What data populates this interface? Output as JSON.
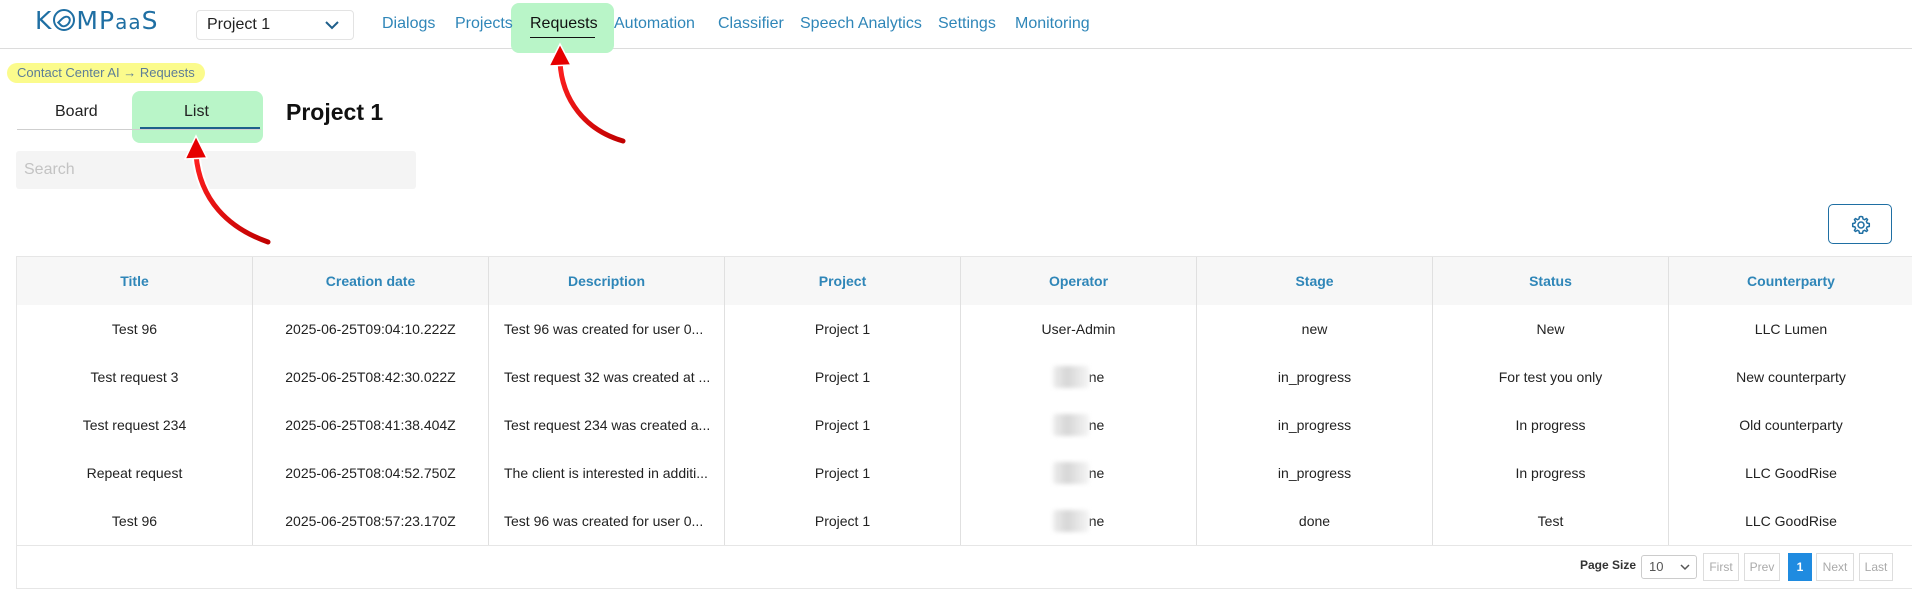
{
  "app": {
    "logo_left": "K",
    "logo_mid": "MP",
    "logo_aa": "aa",
    "logo_right": "S",
    "project_select": "Project 1"
  },
  "nav": {
    "items": [
      "Dialogs",
      "Projects",
      "Requests",
      "Automation",
      "Classifier",
      "Speech Analytics",
      "Settings",
      "Monitoring"
    ],
    "active": "Requests"
  },
  "breadcrumb": "Contact Center AI → Requests",
  "tabs": [
    "Board",
    "List"
  ],
  "active_tab": "List",
  "page_title": "Project 1",
  "search": {
    "placeholder": "Search",
    "value": ""
  },
  "table": {
    "columns": [
      "Title",
      "Creation date",
      "Description",
      "Project",
      "Operator",
      "Stage",
      "Status",
      "Counterparty"
    ],
    "rows": [
      [
        "Test 96",
        "2025-06-25T09:04:10.222Z",
        "Test 96 was created for user 0...",
        "Project 1",
        "User-Admin",
        "new",
        "New",
        "LLC Lumen"
      ],
      [
        "Test request 3",
        "2025-06-25T08:42:30.022Z",
        "Test request 32 was created at ...",
        "Project 1",
        "ne",
        "in_progress",
        "For test you only",
        "New counterparty"
      ],
      [
        "Test request 234",
        "2025-06-25T08:41:38.404Z",
        "Test request 234 was created a...",
        "Project 1",
        "ne",
        "in_progress",
        "In progress",
        "Old counterparty"
      ],
      [
        "Repeat request",
        "2025-06-25T08:04:52.750Z",
        "The client is interested in additi...",
        "Project 1",
        "ne",
        "in_progress",
        "In progress",
        "LLC GoodRise"
      ],
      [
        "Test 96",
        "2025-06-25T08:57:23.170Z",
        "Test 96 was created for user 0...",
        "Project 1",
        "ne",
        "done",
        "Test",
        "LLC GoodRise"
      ]
    ],
    "operator_blurred": [
      false,
      true,
      true,
      true,
      true
    ]
  },
  "pagination": {
    "page_size_label": "Page Size",
    "page_size": "10",
    "first": "First",
    "prev": "Prev",
    "current": "1",
    "next": "Next",
    "last": "Last"
  },
  "colors": {
    "accent": "#2f86b8",
    "highlight": "#b9f5c8",
    "breadcrumb_bg": "#fbfb8c",
    "annotation_arrow": "#e60000"
  }
}
